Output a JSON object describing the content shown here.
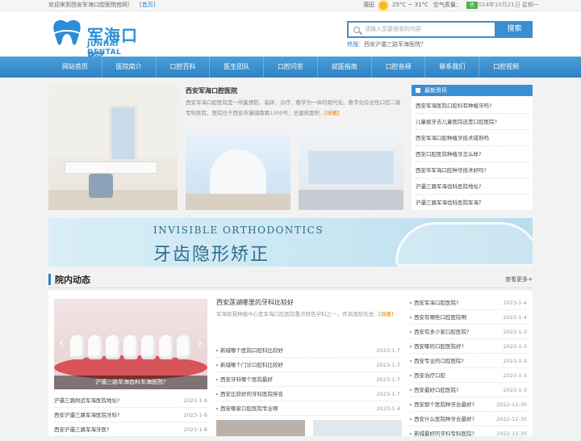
{
  "topbar": {
    "welcome": "欢迎来到西安军海口腔医院官网！",
    "home_link": "[首页]",
    "city": "蒲田",
    "temp": "25°C ~ 31°C",
    "air_label": "空气质量：",
    "air_value": "优",
    "date": "2024年10月21日 星期一"
  },
  "header": {
    "logo_cn": "军海口腔",
    "logo_en": "JUNHAI DENTAL",
    "search_placeholder": "请输入您要搜索的内容",
    "search_button": "搜索",
    "hot_label": "热搜：",
    "hot_link": "西安沪灞三路军海医院？"
  },
  "nav": [
    "网站首页",
    "医院简介",
    "口腔百科",
    "医生团队",
    "口腔问答",
    "就医指南",
    "口腔音频",
    "联系我们",
    "口腔视频"
  ],
  "intro": {
    "title": "西安军海口腔医院",
    "text": "西安军海口腔医院是一所集预防、临床、诊疗、教学为一体的现代化、数字化综合性口腔二级专科医院，医院位于西安市灞城南路1300号，总建筑面积",
    "more": "...[详细]"
  },
  "latest_news": {
    "title": "最新资讯",
    "items": [
      "西安军海医院口腔科有种植牙吗?",
      "儿童拔牙去儿童医院还是口腔医院?",
      "西安军海口腔种植牙技术成熟吗",
      "西安口腔医院种植牙怎么样?",
      "西安市军海口腔种牙技术好吗?",
      "沪灞三路军海齿科医院地址?",
      "沪灞三路军海齿科医院军海？"
    ]
  },
  "banner": {
    "en": "INVISIBLE ORTHODONTICS",
    "cn": "牙齿隐形矫正"
  },
  "section": {
    "title": "院内动态",
    "more": "查看更多+"
  },
  "slide": {
    "caption": "沪灞三路军海齿科军海医院?"
  },
  "list_a": [
    {
      "title": "沪灞三路附近军海医院地址?",
      "date": "2023-1-8"
    },
    {
      "title": "西安沪灞三路军海医院牙科?",
      "date": "2023-1-8"
    },
    {
      "title": "西安沪灞三路军海牙医?",
      "date": "2023-1-8"
    }
  ],
  "feature": {
    "title": "西安莲湖哪里的牙科比较好",
    "text": "军海智慧种植中心是军海口腔医院重点特色学科之一，传承国际先进",
    "more": "...[详细]"
  },
  "list_b": [
    {
      "title": "新城哪个医院口腔科比较好",
      "date": "2023-1-7"
    },
    {
      "title": "新城哪个门诊口腔科比较好",
      "date": "2023-1-7"
    },
    {
      "title": "西安牙科哪个医院最好",
      "date": "2023-1-7"
    },
    {
      "title": "西安比较好的牙科医院排名",
      "date": "2023-1-7"
    },
    {
      "title": "西安哪家口腔医院专业啊",
      "date": "2023-1-4"
    }
  ],
  "list_c": [
    {
      "title": "西安军海口腔医院?",
      "date": "2023-1-4"
    },
    {
      "title": "西安有哪些口腔医院啊",
      "date": "2023-1-4"
    },
    {
      "title": "西安有多少家口腔医院?",
      "date": "2023-1-3"
    },
    {
      "title": "西安哪的口腔医院好?",
      "date": "2023-1-3"
    },
    {
      "title": "西安专业的口腔医院?",
      "date": "2023-1-3"
    },
    {
      "title": "西安治疗口腔",
      "date": "2023-1-3"
    },
    {
      "title": "西安最好口腔医院?",
      "date": "2023-1-3"
    },
    {
      "title": "西安那个医院种牙合最好?",
      "date": "2022-12-30"
    },
    {
      "title": "西安什么医院种牙合最好?",
      "date": "2022-12-30"
    },
    {
      "title": "新城最好的牙科专科医院?",
      "date": "2022-12-30"
    }
  ]
}
